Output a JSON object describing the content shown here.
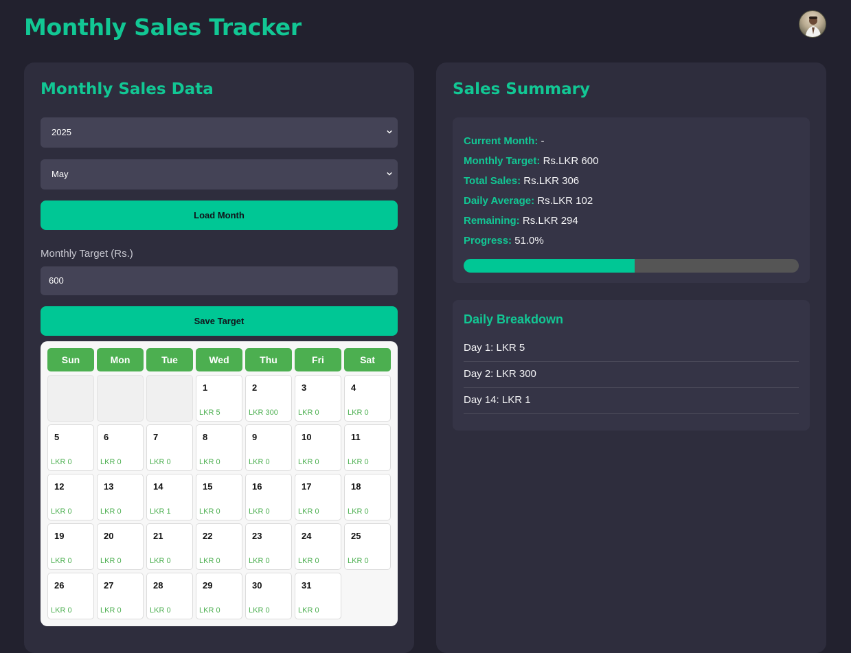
{
  "header": {
    "title": "Monthly Sales Tracker"
  },
  "left_panel": {
    "title": "Monthly Sales Data",
    "year_select": {
      "value": "2025"
    },
    "month_select": {
      "value": "May"
    },
    "load_button": "Load Month",
    "target_label": "Monthly Target (Rs.)",
    "target_input": "600",
    "save_button": "Save Target"
  },
  "calendar": {
    "weekdays": [
      "Sun",
      "Mon",
      "Tue",
      "Wed",
      "Thu",
      "Fri",
      "Sat"
    ],
    "leading_empty": 3,
    "days": [
      {
        "day": "1",
        "amount": "LKR 5"
      },
      {
        "day": "2",
        "amount": "LKR 300"
      },
      {
        "day": "3",
        "amount": "LKR 0"
      },
      {
        "day": "4",
        "amount": "LKR 0"
      },
      {
        "day": "5",
        "amount": "LKR 0"
      },
      {
        "day": "6",
        "amount": "LKR 0"
      },
      {
        "day": "7",
        "amount": "LKR 0"
      },
      {
        "day": "8",
        "amount": "LKR 0"
      },
      {
        "day": "9",
        "amount": "LKR 0"
      },
      {
        "day": "10",
        "amount": "LKR 0"
      },
      {
        "day": "11",
        "amount": "LKR 0"
      },
      {
        "day": "12",
        "amount": "LKR 0"
      },
      {
        "day": "13",
        "amount": "LKR 0"
      },
      {
        "day": "14",
        "amount": "LKR 1"
      },
      {
        "day": "15",
        "amount": "LKR 0"
      },
      {
        "day": "16",
        "amount": "LKR 0"
      },
      {
        "day": "17",
        "amount": "LKR 0"
      },
      {
        "day": "18",
        "amount": "LKR 0"
      },
      {
        "day": "19",
        "amount": "LKR 0"
      },
      {
        "day": "20",
        "amount": "LKR 0"
      },
      {
        "day": "21",
        "amount": "LKR 0"
      },
      {
        "day": "22",
        "amount": "LKR 0"
      },
      {
        "day": "23",
        "amount": "LKR 0"
      },
      {
        "day": "24",
        "amount": "LKR 0"
      },
      {
        "day": "25",
        "amount": "LKR 0"
      },
      {
        "day": "26",
        "amount": "LKR 0"
      },
      {
        "day": "27",
        "amount": "LKR 0"
      },
      {
        "day": "28",
        "amount": "LKR 0"
      },
      {
        "day": "29",
        "amount": "LKR 0"
      },
      {
        "day": "30",
        "amount": "LKR 0"
      },
      {
        "day": "31",
        "amount": "LKR 0"
      }
    ]
  },
  "summary": {
    "title": "Sales Summary",
    "rows": [
      {
        "label": "Current Month:",
        "value": "-"
      },
      {
        "label": "Monthly Target:",
        "value": "Rs.LKR 600"
      },
      {
        "label": "Total Sales:",
        "value": "Rs.LKR 306"
      },
      {
        "label": "Daily Average:",
        "value": "Rs.LKR 102"
      },
      {
        "label": "Remaining:",
        "value": "Rs.LKR 294"
      },
      {
        "label": "Progress:",
        "value": "51.0%"
      }
    ],
    "progress_percent": 51.0
  },
  "breakdown": {
    "title": "Daily Breakdown",
    "items": [
      "Day 1: LKR 5",
      "Day 2: LKR 300",
      "Day 14: LKR 1"
    ]
  },
  "colors": {
    "accent": "#12c794",
    "button": "#00c795",
    "calendar_header": "#4caf50",
    "background": "#22212e",
    "panel": "#2e2d3d"
  },
  "icons": {
    "select_arrow": "chevron-down-icon",
    "avatar": "user-avatar"
  }
}
